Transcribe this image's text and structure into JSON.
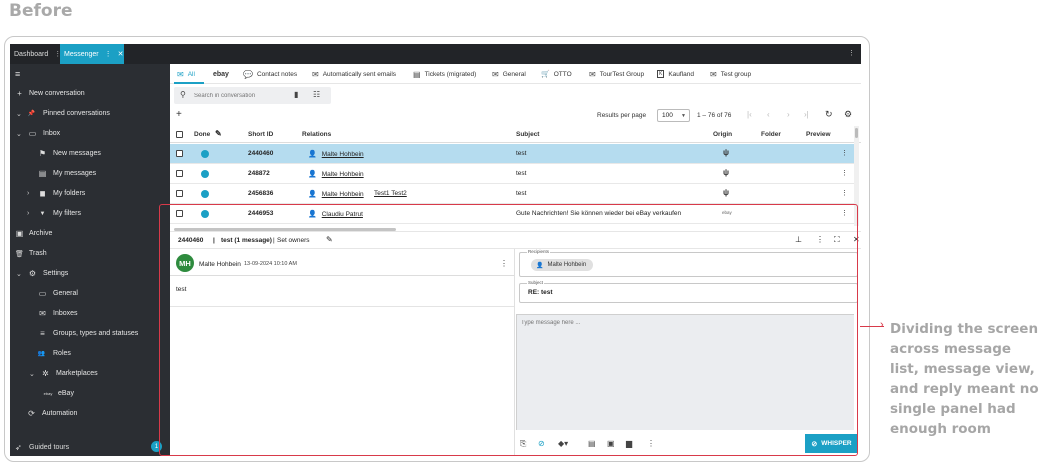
{
  "heading": "Before",
  "app_tabs": [
    {
      "label": "Dashboard",
      "menu": "⋮"
    },
    {
      "label": "Messenger",
      "menu": "⋮",
      "close": "✕"
    }
  ],
  "window_menu": "⋮",
  "sidebar": {
    "items": [
      {
        "label": "New conversation",
        "icon": "plus-icon",
        "glyph": "+"
      },
      {
        "label": "Pinned conversations",
        "icon": "pin-icon",
        "glyph": "📌"
      },
      {
        "label": "Inbox",
        "icon": "inbox-icon",
        "glyph": "▭"
      },
      {
        "label": "New messages",
        "icon": "flag-icon",
        "glyph": "⚑"
      },
      {
        "label": "My messages",
        "icon": "inbox-user-icon",
        "glyph": "▤"
      },
      {
        "label": "My folders",
        "icon": "folder-icon",
        "glyph": "▆"
      },
      {
        "label": "My filters",
        "icon": "filter-icon",
        "glyph": "▼"
      },
      {
        "label": "Archive",
        "icon": "archive-icon",
        "glyph": "▣"
      },
      {
        "label": "Trash",
        "icon": "trash-icon",
        "glyph": "🗑"
      },
      {
        "label": "Settings",
        "icon": "gear-icon",
        "glyph": "⚙"
      },
      {
        "label": "General",
        "icon": "general-icon",
        "glyph": "▭"
      },
      {
        "label": "Inboxes",
        "icon": "mail-icon",
        "glyph": "✉"
      },
      {
        "label": "Groups, types and statuses",
        "icon": "groups-icon",
        "glyph": "≡"
      },
      {
        "label": "Roles",
        "icon": "people-icon",
        "glyph": "👥"
      },
      {
        "label": "Marketplaces",
        "icon": "marketplace-icon",
        "glyph": "✲"
      },
      {
        "label": "eBay",
        "icon": "ebay-icon",
        "glyph": "ebay"
      },
      {
        "label": "Automation",
        "icon": "automation-icon",
        "glyph": "⟳"
      }
    ],
    "guided_tours": "Guided tours",
    "guided_badge": "1"
  },
  "categories": [
    {
      "label": "All",
      "glyph": "✉"
    },
    {
      "label": "",
      "glyph": "ebay"
    },
    {
      "label": "Contact notes",
      "glyph": "💬"
    },
    {
      "label": "Automatically sent emails",
      "glyph": "✉"
    },
    {
      "label": "Tickets (migrated)",
      "glyph": "▤"
    },
    {
      "label": "General",
      "glyph": "✉"
    },
    {
      "label": "OTTO",
      "glyph": "🛒"
    },
    {
      "label": "TourTest Group",
      "glyph": "✉"
    },
    {
      "label": "Kaufland",
      "glyph": "K"
    },
    {
      "label": "Test group",
      "glyph": "✉"
    }
  ],
  "search": {
    "placeholder": "Search in conversation"
  },
  "toolbar": {
    "add": "+",
    "results_label": "Results per page",
    "per_page": "100",
    "range": "1 – 76 of 76"
  },
  "table": {
    "headers": [
      "Done",
      "Short ID",
      "Relations",
      "Subject",
      "Origin",
      "Folder",
      "Preview"
    ],
    "rows": [
      {
        "id": "2440460",
        "relations": [
          "Malte Hohbein"
        ],
        "subject": "test",
        "origin": "ψ",
        "selected": true
      },
      {
        "id": "248872",
        "relations": [
          "Malte Hohbein"
        ],
        "subject": "test",
        "origin": "ψ",
        "selected": false
      },
      {
        "id": "2456836",
        "relations": [
          "Malte Hohbein",
          "Test1 Test2"
        ],
        "subject": "test",
        "origin": "ψ",
        "selected": false
      },
      {
        "id": "2446953",
        "relations": [
          "Claudiu Patrut"
        ],
        "subject": "Gute Nachrichten! Sie können wieder bei eBay verkaufen",
        "origin": "ebay",
        "selected": false
      }
    ]
  },
  "conversation": {
    "id": "2440460",
    "sep": "|",
    "title": "test (1 message)",
    "set_owners": "Set owners"
  },
  "message": {
    "avatar": "MH",
    "sender": "Malte Hohbein",
    "date": "13-09-2024 10:10 AM",
    "body": "test"
  },
  "reply": {
    "recipients_label": "Recipients",
    "recipient": "Malte Hohbein",
    "subject_label": "Subject",
    "subject": "RE: test",
    "placeholder": "Type message here ...",
    "send_label": "WHISPER"
  },
  "annotation": "Dividing the screen across message list, message view, and reply meant no single panel had enough room",
  "colors": {
    "accent": "#1ba0c5",
    "sidebar": "#2b2e33",
    "highlight": "#d83a4a",
    "selected_row": "#b5dcef"
  }
}
